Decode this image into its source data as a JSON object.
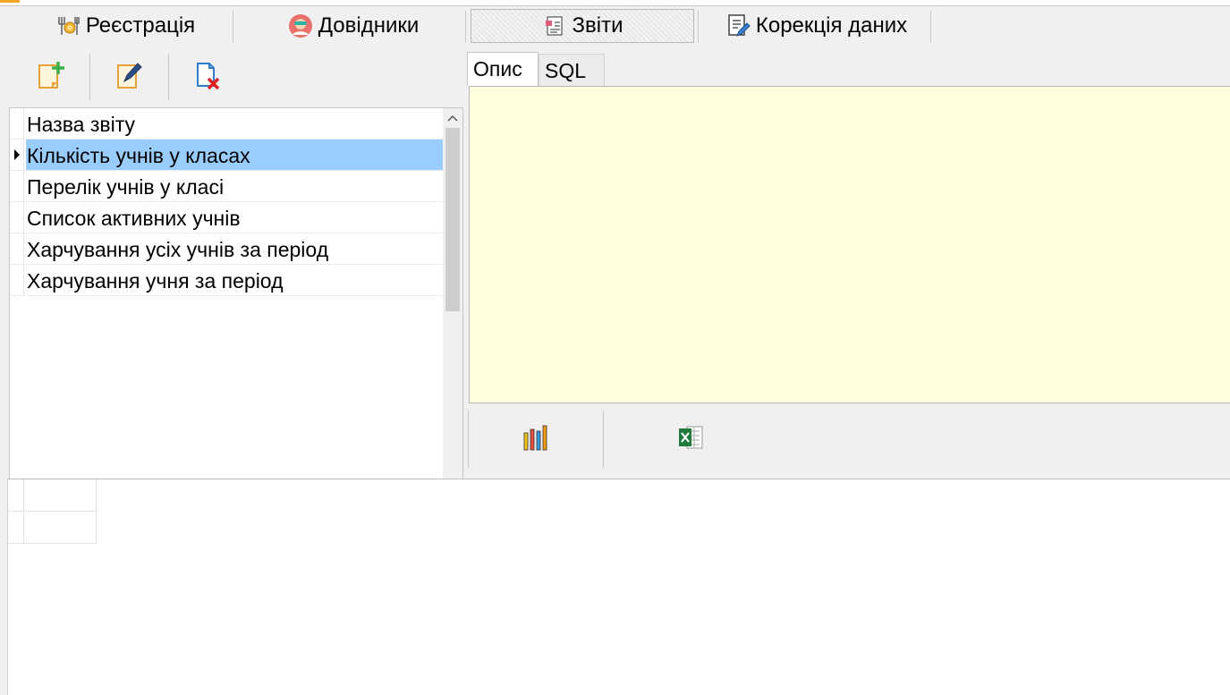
{
  "main_tabs": [
    {
      "label": "Реєстрація",
      "icon": "cutlery-icon"
    },
    {
      "label": "Довідники",
      "icon": "avatar-icon"
    },
    {
      "label": "Звіти",
      "icon": "report-icon",
      "active": true
    },
    {
      "label": "Корекція даних",
      "icon": "document-edit-icon"
    }
  ],
  "toolbar": {
    "buttons": [
      {
        "icon": "add-document-icon"
      },
      {
        "icon": "edit-document-icon"
      },
      {
        "icon": "delete-document-icon"
      }
    ]
  },
  "reports_grid": {
    "header": "Назва звіту",
    "rows": [
      "Кількість учнів у класах",
      "Перелік учнів у класі",
      "Список активних учнів",
      "Харчування усіх учнів за період",
      "Харчування учня за період"
    ],
    "selected_index": 0
  },
  "detail_tabs": [
    {
      "label": "Опис",
      "active": true
    },
    {
      "label": "SQL",
      "active": false
    }
  ],
  "bottom_actions": [
    {
      "icon": "chart-bars-icon"
    },
    {
      "icon": "excel-icon"
    }
  ],
  "colors": {
    "selection": "#99ccff",
    "memo_background": "#ffffe0",
    "window_background": "#f0f0f0"
  }
}
